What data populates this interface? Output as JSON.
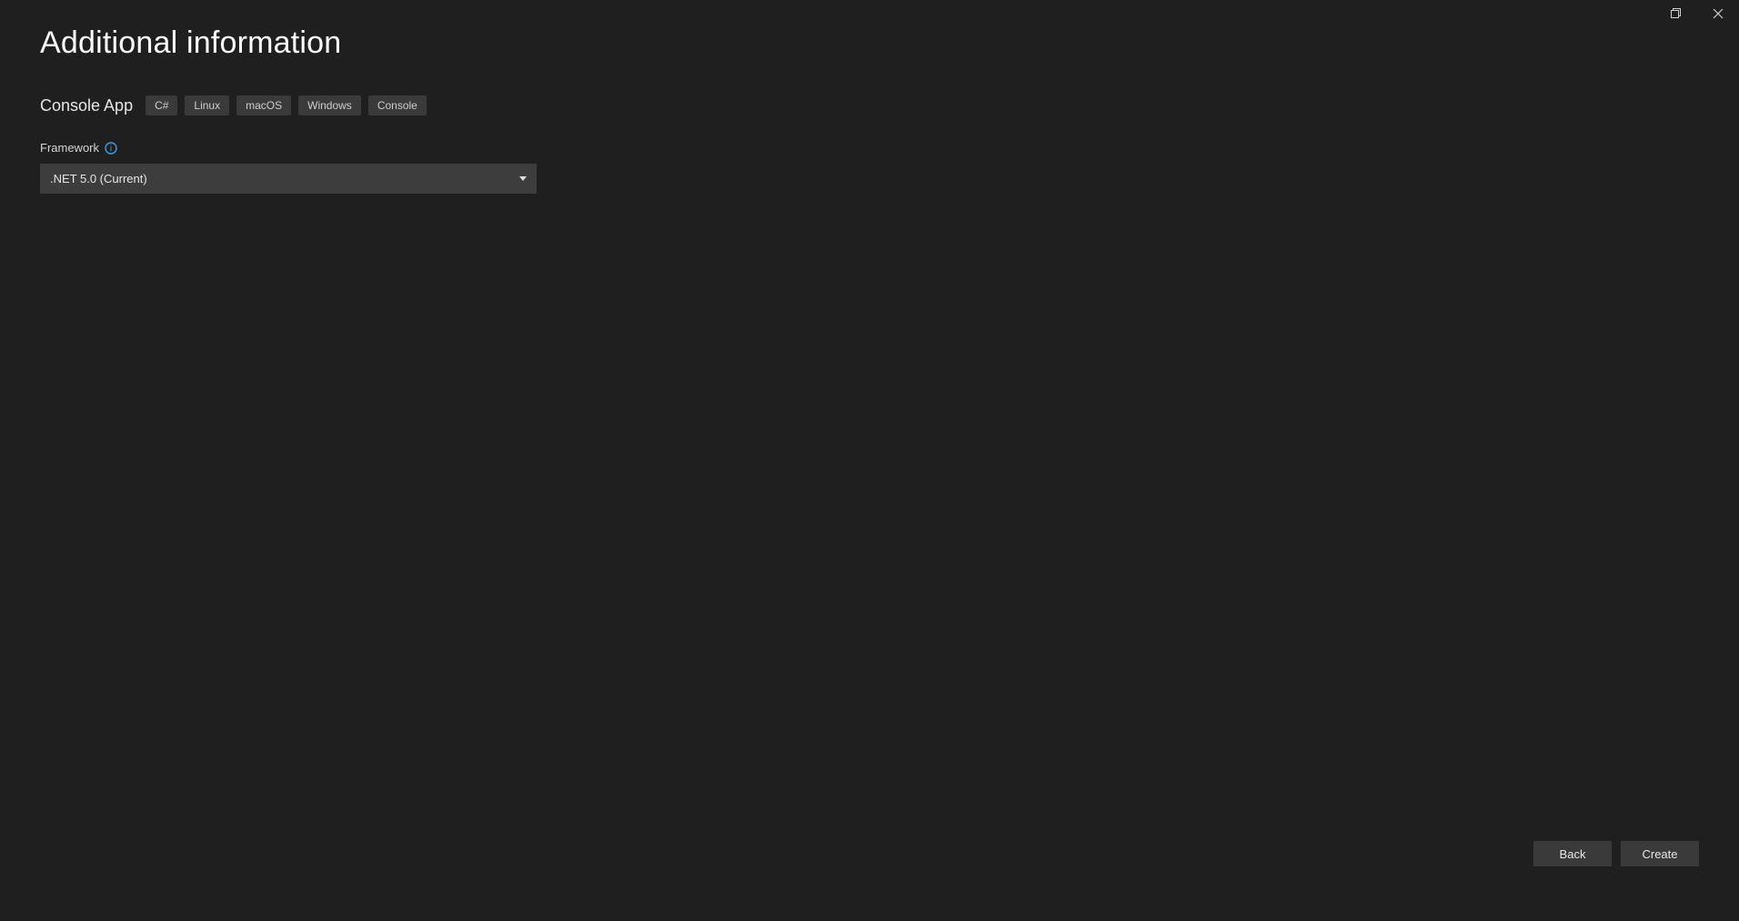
{
  "page": {
    "title": "Additional information"
  },
  "project": {
    "type": "Console App",
    "tags": [
      "C#",
      "Linux",
      "macOS",
      "Windows",
      "Console"
    ]
  },
  "framework": {
    "label": "Framework",
    "selected": ".NET 5.0 (Current)"
  },
  "buttons": {
    "back": "Back",
    "create": "Create"
  }
}
